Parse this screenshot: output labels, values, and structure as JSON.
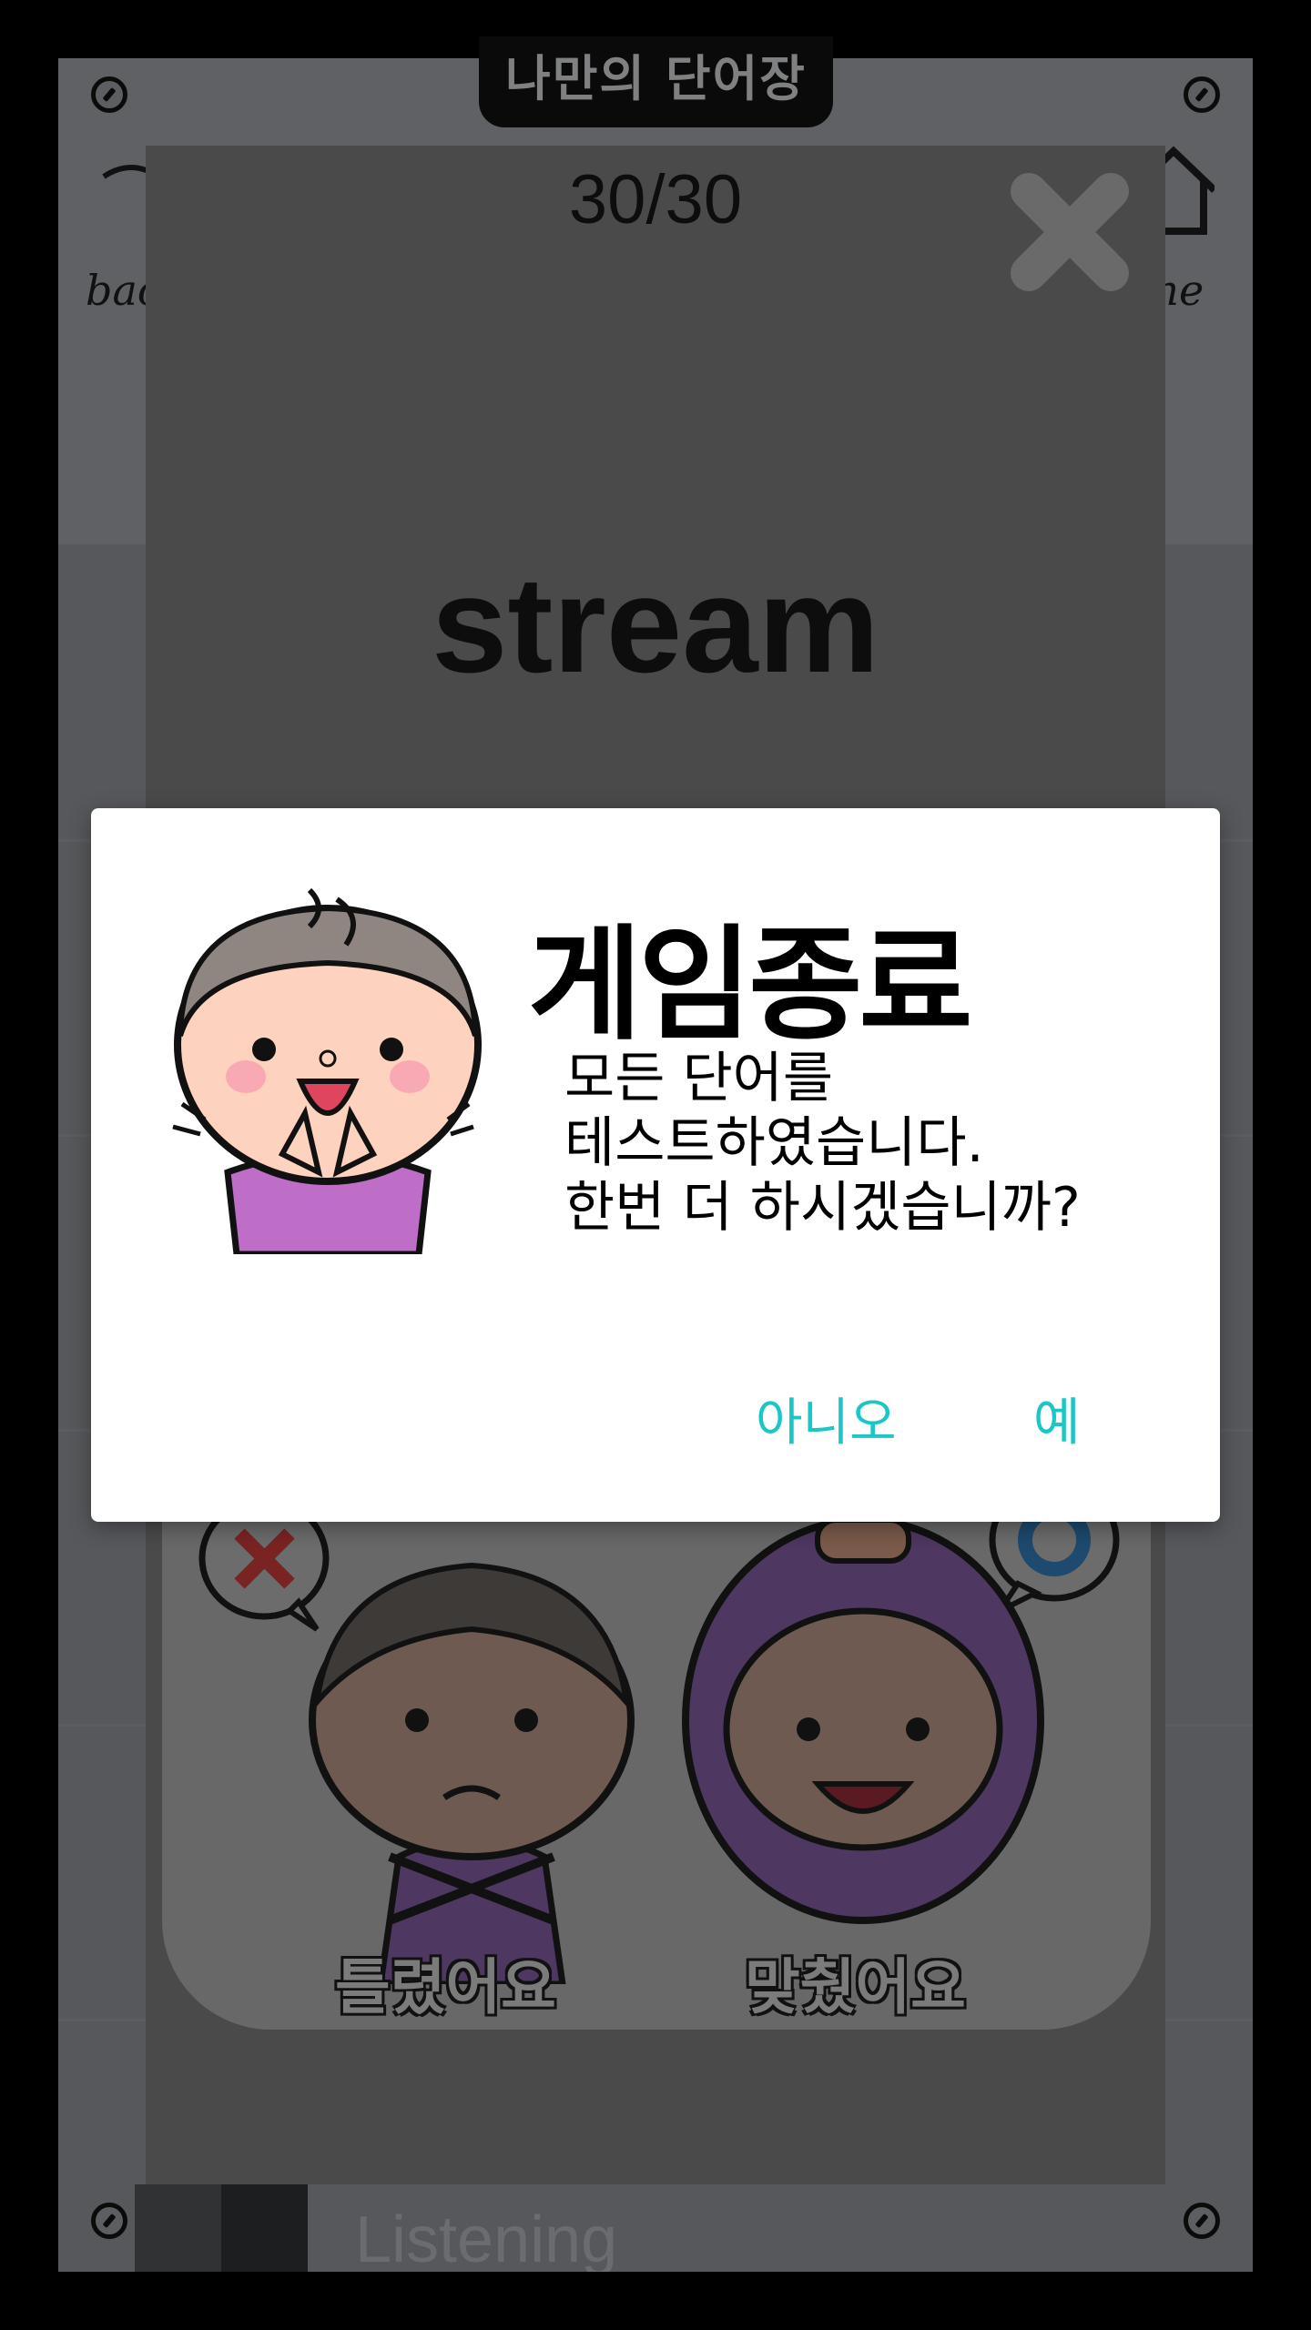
{
  "app": {
    "title": "나만의 단어장",
    "back_label": "back",
    "home_label": "home",
    "background_section_label": "Listening"
  },
  "card": {
    "counter": "30/30",
    "word": "stream",
    "close_icon": "close-x-icon",
    "answers": {
      "wrong_label": "틀렸어요",
      "correct_label": "맞췄어요",
      "wrong_icon": "x-mark-bubble-icon",
      "correct_icon": "o-mark-bubble-icon"
    }
  },
  "dialog": {
    "title": "게임종료",
    "message_lines": [
      "모든 단어를",
      "테스트하였습니다.",
      "한번 더 하시겠습니까?"
    ],
    "no_label": "아니오",
    "yes_label": "예",
    "button_color": "#1dc6c6"
  }
}
